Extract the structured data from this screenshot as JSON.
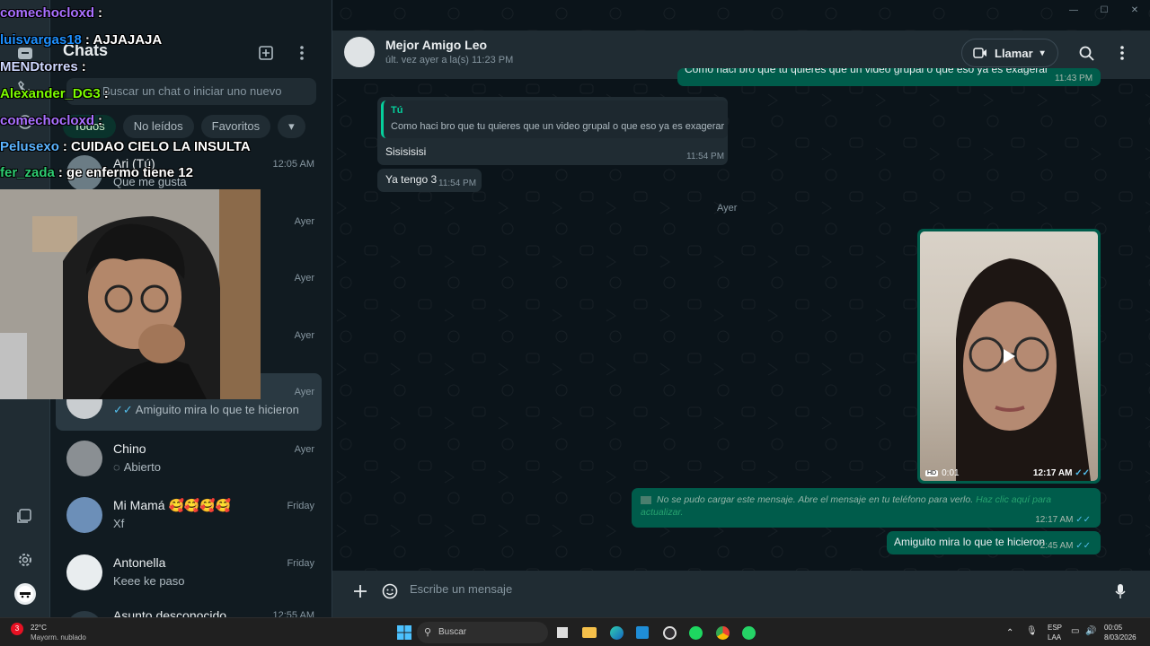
{
  "window": {
    "minimize": "—",
    "maximize": "☐",
    "close": "✕"
  },
  "chats": {
    "title": "Chats",
    "search_placeholder": "Buscar un chat o iniciar uno nuevo",
    "filters": [
      "Todos",
      "No leídos",
      "Favoritos"
    ],
    "items": [
      {
        "name": "Ari (Tú)",
        "preview": "Que me gusta",
        "time": "12:05 AM"
      },
      {
        "name": "",
        "preview": "",
        "time": "Ayer"
      },
      {
        "name": "",
        "preview": "",
        "time": "Ayer"
      },
      {
        "name": "",
        "preview": "",
        "time": "Ayer"
      },
      {
        "name": "",
        "preview": "Amiguito mira lo que te hicieron",
        "time": "Ayer"
      },
      {
        "name": "Chino",
        "preview": "Abierto",
        "time": "Ayer"
      },
      {
        "name": "Mi Mamá 🥰🥰🥰🥰",
        "preview": "Xf",
        "time": "Friday"
      },
      {
        "name": "Antonella",
        "preview": "Keee ke paso",
        "time": "Friday"
      },
      {
        "name": "Asunto desconocido",
        "preview": "",
        "time": "12:55 AM"
      }
    ]
  },
  "conversation": {
    "contact_name": "Mejor Amigo Leo",
    "status": "últ. vez ayer a la(s) 11:23 PM",
    "call_label": "Llamar",
    "top_partial_text": "Como haci bro que tu quieres que un video grupal o que eso ya es exagerar",
    "top_partial_time": "11:43 PM",
    "quote_author": "Tú",
    "quote_text": "Como haci bro que tu quieres que un video grupal o que eso ya es exagerar",
    "reply1_text": "Sisisisisi",
    "reply1_time": "11:54 PM",
    "reply2_text": "Ya tengo 3",
    "reply2_time": "11:54 PM",
    "day_separator": "Ayer",
    "video_duration": "0:01",
    "video_time": "12:17 AM",
    "hd_label": "HD",
    "failed_text": "No se pudo cargar este mensaje. Abre el mensaje en tu teléfono para verlo.",
    "failed_link": "Haz clic aquí para actualizar.",
    "failed_time": "12:17 AM",
    "last_text": "Amiguito mira lo que te hicieron",
    "last_time": "2:45 AM",
    "compose_placeholder": "Escribe un mensaje"
  },
  "overlay_chat": [
    {
      "user": "comechocloxd",
      "msg": ":",
      "color": "#a970ff"
    },
    {
      "user": "luisvargas18",
      "msg": ": AJJAJAJA",
      "color": "#1e90ff"
    },
    {
      "user": "MENDtorres",
      "msg": ":",
      "color": "#cfd8ff"
    },
    {
      "user": "Alexander_DG3",
      "msg": ":",
      "color": "#7cfc00"
    },
    {
      "user": "comechocloxd",
      "msg": ":",
      "color": "#a970ff"
    },
    {
      "user": "Pelusexo",
      "msg": ": CUIDAO CIELO LA INSULTA",
      "color": "#5bb4ff"
    },
    {
      "user": "fer_zada",
      "msg": ": ge enfermo tiene 12",
      "color": "#2ecc71"
    }
  ],
  "taskbar": {
    "weather_temp": "22°C",
    "weather_desc": "Mayorm. nublado",
    "weather_badge": "3",
    "search_label": "Buscar",
    "lang_top": "ESP",
    "lang_bottom": "LAA",
    "clock_time": "00:05",
    "clock_date": "8/03/2026"
  },
  "colors": {
    "accent": "#00a884",
    "outgoing": "#005c4b",
    "incoming": "#202c33",
    "ticks": "#53bdeb"
  }
}
